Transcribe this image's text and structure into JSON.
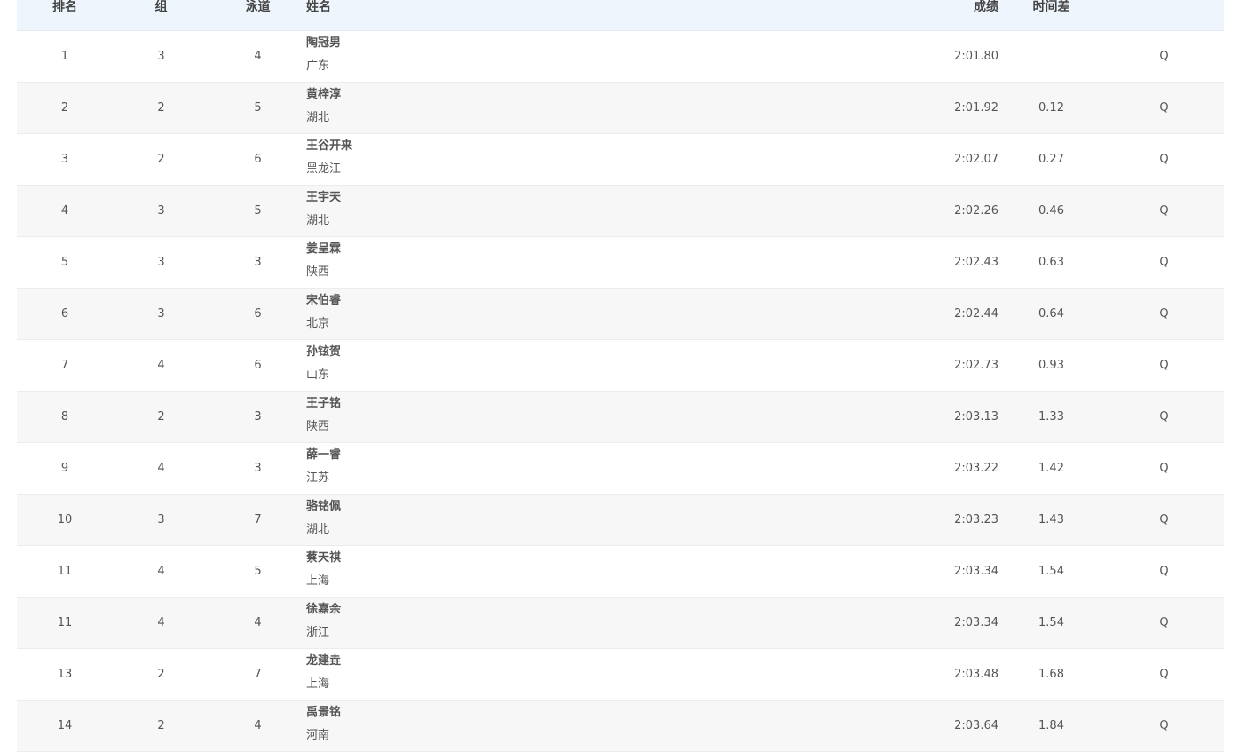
{
  "headers": {
    "rank": "排名",
    "group": "组",
    "lane": "泳道",
    "name": "姓名",
    "score": "成绩",
    "diff": "时间差"
  },
  "rows": [
    {
      "rank": "1",
      "group": "3",
      "lane": "4",
      "name": "陶冠男",
      "team": "广东",
      "score": "2:01.80",
      "diff": "",
      "q": "Q"
    },
    {
      "rank": "2",
      "group": "2",
      "lane": "5",
      "name": "黄梓淳",
      "team": "湖北",
      "score": "2:01.92",
      "diff": "0.12",
      "q": "Q"
    },
    {
      "rank": "3",
      "group": "2",
      "lane": "6",
      "name": "王谷开来",
      "team": "黑龙江",
      "score": "2:02.07",
      "diff": "0.27",
      "q": "Q"
    },
    {
      "rank": "4",
      "group": "3",
      "lane": "5",
      "name": "王宇天",
      "team": "湖北",
      "score": "2:02.26",
      "diff": "0.46",
      "q": "Q"
    },
    {
      "rank": "5",
      "group": "3",
      "lane": "3",
      "name": "姜呈霖",
      "team": "陕西",
      "score": "2:02.43",
      "diff": "0.63",
      "q": "Q"
    },
    {
      "rank": "6",
      "group": "3",
      "lane": "6",
      "name": "宋伯睿",
      "team": "北京",
      "score": "2:02.44",
      "diff": "0.64",
      "q": "Q"
    },
    {
      "rank": "7",
      "group": "4",
      "lane": "6",
      "name": "孙铉贺",
      "team": "山东",
      "score": "2:02.73",
      "diff": "0.93",
      "q": "Q"
    },
    {
      "rank": "8",
      "group": "2",
      "lane": "3",
      "name": "王子铭",
      "team": "陕西",
      "score": "2:03.13",
      "diff": "1.33",
      "q": "Q"
    },
    {
      "rank": "9",
      "group": "4",
      "lane": "3",
      "name": "薛一睿",
      "team": "江苏",
      "score": "2:03.22",
      "diff": "1.42",
      "q": "Q"
    },
    {
      "rank": "10",
      "group": "3",
      "lane": "7",
      "name": "骆铭佩",
      "team": "湖北",
      "score": "2:03.23",
      "diff": "1.43",
      "q": "Q"
    },
    {
      "rank": "11",
      "group": "4",
      "lane": "5",
      "name": "蔡天祺",
      "team": "上海",
      "score": "2:03.34",
      "diff": "1.54",
      "q": "Q"
    },
    {
      "rank": "11",
      "group": "4",
      "lane": "4",
      "name": "徐嘉余",
      "team": "浙江",
      "score": "2:03.34",
      "diff": "1.54",
      "q": "Q"
    },
    {
      "rank": "13",
      "group": "2",
      "lane": "7",
      "name": "龙建垚",
      "team": "上海",
      "score": "2:03.48",
      "diff": "1.68",
      "q": "Q"
    },
    {
      "rank": "14",
      "group": "2",
      "lane": "4",
      "name": "禹景铭",
      "team": "河南",
      "score": "2:03.64",
      "diff": "1.84",
      "q": "Q"
    }
  ]
}
